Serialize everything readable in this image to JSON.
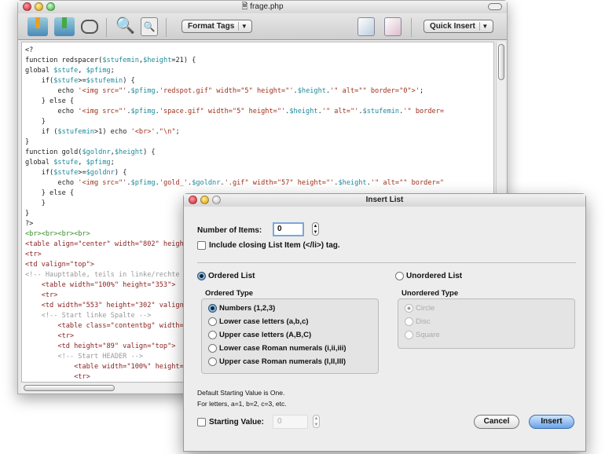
{
  "window": {
    "title": "frage.php"
  },
  "toolbar": {
    "format_tags": "Format Tags",
    "quick_insert": "Quick Insert"
  },
  "editor": {
    "lines": [
      [
        [
          "k",
          "<?"
        ]
      ],
      [
        [
          "k",
          "function redspacer("
        ],
        [
          "v",
          "$stufemin"
        ],
        [
          "k",
          ","
        ],
        [
          "v",
          "$height"
        ],
        [
          "k",
          "=21) {"
        ]
      ],
      [
        [
          "k",
          "global "
        ],
        [
          "v",
          "$stufe"
        ],
        [
          "k",
          ", "
        ],
        [
          "v",
          "$pfimg"
        ],
        [
          "k",
          ";"
        ]
      ],
      [
        [
          "k",
          "    if("
        ],
        [
          "v",
          "$stufe"
        ],
        [
          "k",
          ">="
        ],
        [
          "v",
          "$stufemin"
        ],
        [
          "k",
          ") {"
        ]
      ],
      [
        [
          "k",
          "        echo "
        ],
        [
          "s",
          "'<img src=\"'"
        ],
        [
          "k",
          "."
        ],
        [
          "v",
          "$pfimg"
        ],
        [
          "k",
          "."
        ],
        [
          "s",
          "'redspot.gif\" width=\"5\" height=\"'"
        ],
        [
          "k",
          "."
        ],
        [
          "v",
          "$height"
        ],
        [
          "k",
          "."
        ],
        [
          "s",
          "'\" alt=\"\" border=\"0\">'"
        ],
        [
          "k",
          ";"
        ]
      ],
      [
        [
          "k",
          "    } else {"
        ]
      ],
      [
        [
          "k",
          "        echo "
        ],
        [
          "s",
          "'<img src=\"'"
        ],
        [
          "k",
          "."
        ],
        [
          "v",
          "$pfimg"
        ],
        [
          "k",
          "."
        ],
        [
          "s",
          "'space.gif\" width=\"5\" height=\"'"
        ],
        [
          "k",
          "."
        ],
        [
          "v",
          "$height"
        ],
        [
          "k",
          "."
        ],
        [
          "s",
          "'\" alt=\"'"
        ],
        [
          "k",
          "."
        ],
        [
          "v",
          "$stufemin"
        ],
        [
          "k",
          "."
        ],
        [
          "s",
          "'\" border="
        ]
      ],
      [
        [
          "k",
          "    }"
        ]
      ],
      [
        [
          "k",
          "    if ("
        ],
        [
          "v",
          "$stufemin"
        ],
        [
          "k",
          ">1) echo "
        ],
        [
          "s",
          "'<br>'"
        ],
        [
          "k",
          "."
        ],
        [
          "s",
          "\"\\n\""
        ],
        [
          "k",
          ";"
        ]
      ],
      [
        [
          "k",
          "}"
        ]
      ],
      [
        [
          "k",
          "function gold("
        ],
        [
          "v",
          "$goldnr"
        ],
        [
          "k",
          ","
        ],
        [
          "v",
          "$height"
        ],
        [
          "k",
          ") {"
        ]
      ],
      [
        [
          "k",
          "global "
        ],
        [
          "v",
          "$stufe"
        ],
        [
          "k",
          ", "
        ],
        [
          "v",
          "$pfimg"
        ],
        [
          "k",
          ";"
        ]
      ],
      [
        [
          "k",
          "    if("
        ],
        [
          "v",
          "$stufe"
        ],
        [
          "k",
          ">="
        ],
        [
          "v",
          "$goldnr"
        ],
        [
          "k",
          ") {"
        ]
      ],
      [
        [
          "k",
          "        echo "
        ],
        [
          "s",
          "'<img src=\"'"
        ],
        [
          "k",
          "."
        ],
        [
          "v",
          "$pfimg"
        ],
        [
          "k",
          "."
        ],
        [
          "s",
          "'gold_'"
        ],
        [
          "k",
          "."
        ],
        [
          "v",
          "$goldnr"
        ],
        [
          "k",
          "."
        ],
        [
          "s",
          "'.gif\" width=\"57\" height=\"'"
        ],
        [
          "k",
          "."
        ],
        [
          "v",
          "$height"
        ],
        [
          "k",
          "."
        ],
        [
          "s",
          "'\" alt=\"\" border=\""
        ]
      ],
      [
        [
          "k",
          "    } else {"
        ]
      ],
      [
        [
          "k",
          "    }"
        ]
      ],
      [
        [
          "k",
          "}"
        ]
      ],
      [
        [
          "k",
          "?>"
        ]
      ],
      [
        [
          "g",
          "<br><br><br><br>"
        ]
      ],
      [
        [
          "h",
          "<table align=\"center\" width=\"802\" height=\"\">"
        ]
      ],
      [
        [
          "h",
          "<tr>"
        ]
      ],
      [
        [
          "h",
          "<td valign=\"top\">"
        ]
      ],
      [
        [
          "c",
          "<!-- Haupttable, teils in linke/rechte Spalte -->"
        ]
      ],
      [
        [
          "h",
          "    <table width=\"100%\" height=\"353\">"
        ]
      ],
      [
        [
          "h",
          "    <tr>"
        ]
      ],
      [
        [
          "h",
          "    <td width=\"553\" height=\"302\" valign=\"top\">"
        ]
      ],
      [
        [
          "c",
          "    <!-- Start linke Spalte -->"
        ]
      ],
      [
        [
          "h",
          "        <table class=\"contentbg\" width=\"\">"
        ]
      ],
      [
        [
          "h",
          "        <tr>"
        ]
      ],
      [
        [
          "h",
          "        <td height=\"89\" valign=\"top\">"
        ]
      ],
      [
        [
          "c",
          "        <!-- Start HEADER -->"
        ]
      ],
      [
        [
          "h",
          "            <table width=\"100%\" height=\"\">"
        ]
      ],
      [
        [
          "h",
          "            <tr>"
        ]
      ]
    ]
  },
  "dialog": {
    "title": "Insert List",
    "number_label": "Number of Items:",
    "number_value": "0",
    "closing_tag_label": "Include closing List Item (</li>) tag.",
    "ordered_label": "Ordered List",
    "unordered_label": "Unordered List",
    "ordered_type_label": "Ordered Type",
    "unordered_type_label": "Unordered Type",
    "ordered_types": [
      "Numbers (1,2,3)",
      "Lower case letters (a,b,c)",
      "Upper case letters (A,B,C)",
      "Lower case Roman numerals (i,ii,iii)",
      "Upper case Roman numerals (I,II,III)"
    ],
    "unordered_types": [
      "Circle",
      "Disc",
      "Square"
    ],
    "hint1": "Default Starting Value is One.",
    "hint2": "For letters, a=1, b=2, c=3, etc.",
    "starting_label": "Starting Value:",
    "starting_value": "0",
    "cancel": "Cancel",
    "insert": "Insert"
  }
}
